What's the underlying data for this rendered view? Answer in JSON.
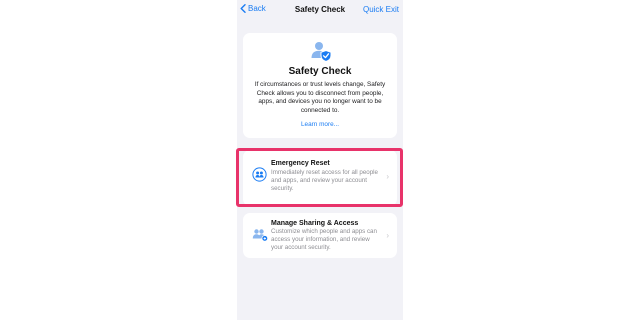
{
  "nav": {
    "back_label": "Back",
    "title": "Safety Check",
    "right_label": "Quick Exit"
  },
  "intro": {
    "icon": "person-shield-icon",
    "title": "Safety Check",
    "description": "If circumstances or trust levels change, Safety Check allows you to disconnect from people, apps, and devices you no longer want to be connected to.",
    "link_label": "Learn more..."
  },
  "options": [
    {
      "icon": "people-reset-icon",
      "title": "Emergency Reset",
      "description": "Immediately reset access for all people and apps, and review your account security."
    },
    {
      "icon": "people-sharing-icon",
      "title": "Manage Sharing & Access",
      "description": "Customize which people and apps can access your information, and review your account security."
    }
  ],
  "colors": {
    "accent": "#1a7cf3",
    "highlight": "#e8336a",
    "background": "#f2f2f7"
  }
}
